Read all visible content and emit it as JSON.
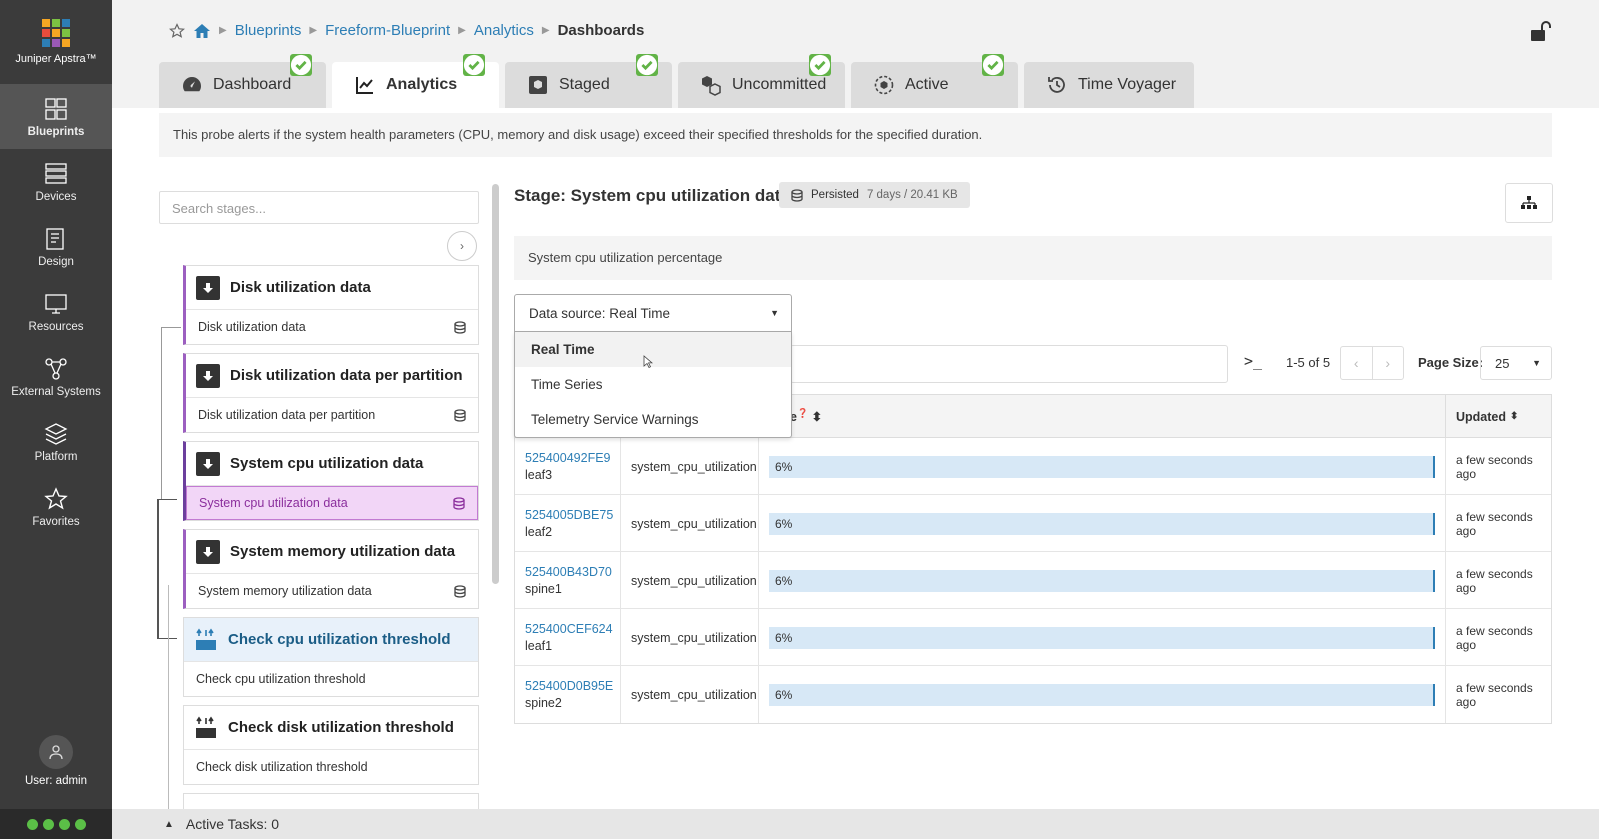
{
  "app": {
    "name": "Juniper Apstra™",
    "logo_colors": [
      "#f5a623",
      "#7cc242",
      "#2d7eb5",
      "#e74c3c",
      "#f5a623",
      "#7cc242",
      "#2d7eb5",
      "#9b59b6",
      "#f5a623"
    ]
  },
  "sidebar": {
    "items": [
      {
        "label": "Blueprints",
        "icon": "blueprints-icon",
        "active": true
      },
      {
        "label": "Devices",
        "icon": "devices-icon"
      },
      {
        "label": "Design",
        "icon": "design-icon"
      },
      {
        "label": "Resources",
        "icon": "resources-icon"
      },
      {
        "label": "External Systems",
        "icon": "external-systems-icon"
      },
      {
        "label": "Platform",
        "icon": "platform-icon"
      },
      {
        "label": "Favorites",
        "icon": "star-icon"
      }
    ],
    "user": "User: admin"
  },
  "breadcrumb": {
    "items": [
      "Blueprints",
      "Freeform-Blueprint",
      "Analytics"
    ],
    "current": "Dashboards"
  },
  "tabs": [
    {
      "label": "Dashboard",
      "icon": "gauge-icon",
      "badge": true
    },
    {
      "label": "Analytics",
      "icon": "chart-icon",
      "badge": true,
      "active": true
    },
    {
      "label": "Staged",
      "icon": "staged-icon",
      "badge": true
    },
    {
      "label": "Uncommitted",
      "icon": "uncommitted-icon",
      "badge": true
    },
    {
      "label": "Active",
      "icon": "active-icon",
      "badge": true
    },
    {
      "label": "Time Voyager",
      "icon": "history-icon"
    }
  ],
  "probe_description": "This probe alerts if the system health parameters (CPU, memory and disk usage) exceed their specified thresholds for the specified duration.",
  "left_panel": {
    "search_placeholder": "Search stages...",
    "stages": [
      {
        "title": "Disk utilization data",
        "sub": "Disk utilization data",
        "kind": "source"
      },
      {
        "title": "Disk utilization data per partition",
        "sub": "Disk utilization data per partition",
        "kind": "source"
      },
      {
        "title": "System cpu utilization data",
        "sub": "System cpu utilization data",
        "kind": "source",
        "selected": true
      },
      {
        "title": "System memory utilization data",
        "sub": "System memory utilization data",
        "kind": "source"
      },
      {
        "title": "Check cpu utilization threshold",
        "sub": "Check cpu utilization threshold",
        "kind": "processor",
        "highlight": true
      },
      {
        "title": "Check disk utilization threshold",
        "sub": "Check disk utilization threshold",
        "kind": "processor"
      }
    ]
  },
  "stage": {
    "title": "Stage: System cpu utilization data",
    "persisted_label": "Persisted",
    "persisted_info": "7 days / 20.41 KB",
    "description": "System cpu utilization percentage"
  },
  "data_source": {
    "selected": "Data source: Real Time",
    "options": [
      "Real Time",
      "Time Series",
      "Telemetry Service Warnings"
    ],
    "hovered_index": 0
  },
  "pagination": {
    "range": "1-5 of 5",
    "page_size_label": "Page Size:",
    "page_size": "25"
  },
  "table": {
    "value_header_fragment": "e",
    "updated_header": "Updated",
    "rows": [
      {
        "system_id": "525400492FE9",
        "hostname": "leaf3",
        "type": "system_cpu_utilization",
        "value": "6%",
        "value_pct": 6,
        "updated": "a few seconds ago"
      },
      {
        "system_id": "5254005DBE75",
        "hostname": "leaf2",
        "type": "system_cpu_utilization",
        "value": "6%",
        "value_pct": 6,
        "updated": "a few seconds ago"
      },
      {
        "system_id": "525400B43D70",
        "hostname": "spine1",
        "type": "system_cpu_utilization",
        "value": "6%",
        "value_pct": 6,
        "updated": "a few seconds ago"
      },
      {
        "system_id": "525400CEF624",
        "hostname": "leaf1",
        "type": "system_cpu_utilization",
        "value": "6%",
        "value_pct": 6,
        "updated": "a few seconds ago"
      },
      {
        "system_id": "525400D0B95E",
        "hostname": "spine2",
        "type": "system_cpu_utilization",
        "value": "6%",
        "value_pct": 6,
        "updated": "a few seconds ago"
      }
    ]
  },
  "bottom": {
    "active_tasks": "Active Tasks: 0"
  },
  "colors": {
    "accent": "#2d7eb5",
    "badge_green": "#62b347",
    "selected_stage": "#f2d6f7"
  }
}
